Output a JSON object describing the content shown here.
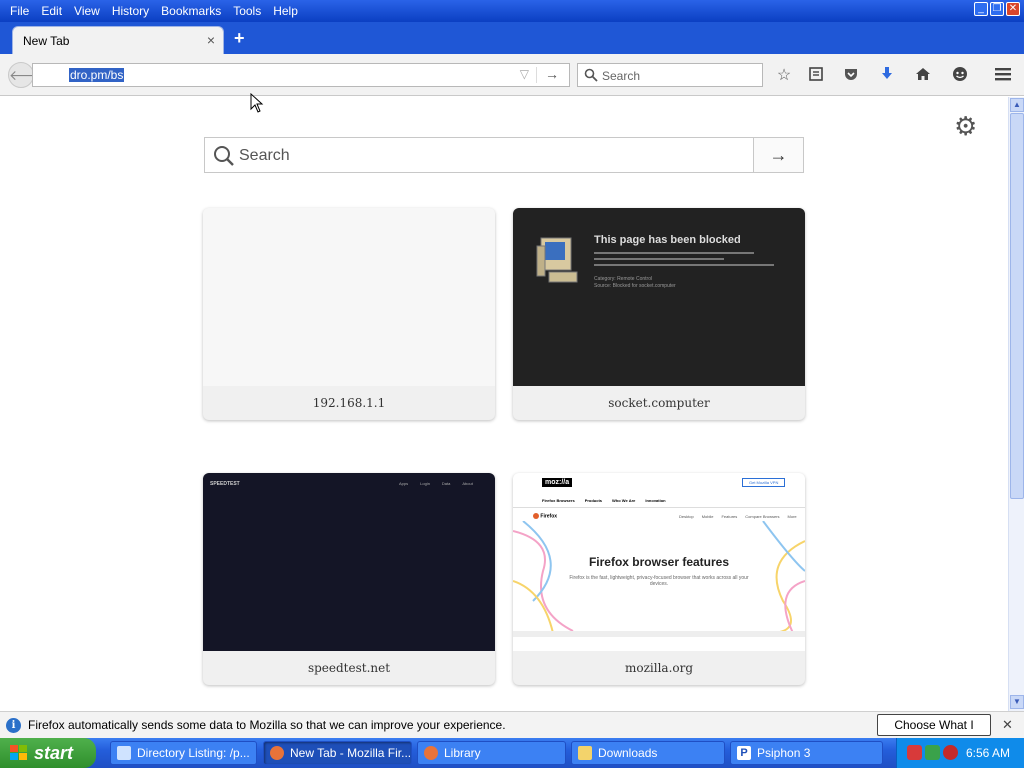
{
  "menu": [
    "File",
    "Edit",
    "View",
    "History",
    "Bookmarks",
    "Tools",
    "Help"
  ],
  "tab": {
    "title": "New Tab",
    "close": "×",
    "new": "+"
  },
  "navbar": {
    "url": "dro.pm/bs",
    "search_placeholder": "Search"
  },
  "newtab_page": {
    "search_placeholder": "Search",
    "tiles": [
      {
        "label": "192.168.1.1"
      },
      {
        "label": "socket.computer",
        "thumb_title": "This page has been blocked",
        "thumb_lines": [
          "Category: Remote Control",
          "Source: Blocked for socket.computer"
        ]
      },
      {
        "label": "speedtest.net",
        "thumb_brand": "SPEEDTEST",
        "thumb_nav": [
          "Apps",
          "Login",
          "Data",
          "About"
        ]
      },
      {
        "label": "mozilla.org",
        "thumb_logo": "moz://a",
        "thumb_button": "Get Mozilla VPN",
        "thumb_nav": [
          "Firefox Browsers",
          "Products",
          "Who We Are",
          "Innovation"
        ],
        "thumb_sub": "Firefox",
        "thumb_subnav": [
          "Desktop",
          "Mobile",
          "Features",
          "Compare Browsers",
          "More"
        ],
        "thumb_heading": "Firefox browser features",
        "thumb_text": "Firefox is the fast, lightweight, privacy-focused browser that works across all your devices."
      }
    ]
  },
  "notification": {
    "message": "Firefox automatically sends some data to Mozilla so that we can improve your experience.",
    "button": "Choose What I Share",
    "close": "✕"
  },
  "taskbar": {
    "start": "start",
    "items": [
      "Directory Listing: /p...",
      "New Tab - Mozilla Fir...",
      "Library",
      "Downloads",
      "Psiphon 3"
    ],
    "clock": "6:56 AM"
  }
}
